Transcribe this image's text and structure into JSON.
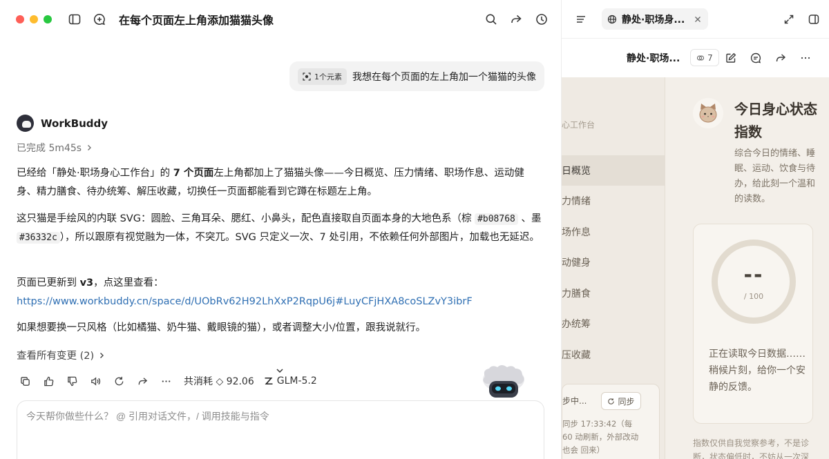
{
  "chat": {
    "title": "在每个页面左上角添加猫猫头像",
    "user_message": {
      "chip_label": "1个元素",
      "text": "我想在每个页面的左上角加一个猫猫的头像"
    },
    "assistant": {
      "name": "WorkBuddy",
      "status": "已完成 5m45s",
      "p1_pre": "已经给「静处·职场身心工作台」的 ",
      "p1_bold": "7 个页面",
      "p1_post": "左上角都加上了猫猫头像——今日概览、压力情绪、职场作息、运动健身、精力膳食、待办统筹、解压收藏，切换任一页面都能看到它蹲在标题左上角。",
      "p2_pre": "这只猫是手绘风的内联 SVG：圆脸、三角耳朵、腮红、小鼻头，配色直接取自页面本身的大地色系（棕 ",
      "p2_code1": "#b08768",
      "p2_mid": " 、墨 ",
      "p2_code2": "#36332c",
      "p2_post": "），所以跟原有视觉融为一体，不突兀。SVG 只定义一次、7 处引用，不依赖任何外部图片，加载也无延迟。",
      "p3_pre": "页面已更新到 ",
      "p3_bold": "v3",
      "p3_post": "，点这里查看：",
      "p3_link": "https://www.workbuddy.cn/space/d/UObRv62H92LhXxP2RqpU6j#LuyCFjHXA8coSLZvY3ibrF",
      "p4": "如果想要换一只风格（比如橘猫、奶牛猫、戴眼镜的猫），或者调整大小/位置，跟我说就行。",
      "changes": "查看所有变更 (2)",
      "cost": "共消耗 ◇ 92.06",
      "model": "GLM-5.2"
    },
    "composer_placeholder": "今天帮你做些什么？ @ 引用对话文件，/ 调用技能与指令"
  },
  "preview": {
    "tab_label": "静处·职场身...",
    "title": "静处·职场...",
    "version_count": "7",
    "brand": "心工作台",
    "nav": [
      "日概览",
      "力情绪",
      "场作息",
      "动健身",
      "力膳食",
      "办统筹",
      "压收藏"
    ],
    "sync_status": "步中...",
    "sync_button": "同步",
    "sync_note": "同步 17:33:42（每 60 动刷新，外部改动也会 回来）",
    "page_title": "今日身心状态指数",
    "page_desc": "综合今日的情绪、睡眠、运动、饮食与待办，给此刻一个温和的读数。",
    "score_value": "--",
    "score_max": "/ 100",
    "score_msg": "正在读取今日数据……稍候片刻，给你一个安静的反馈。",
    "footer": "指数仅供自我觉察参考，不是诊断，状态偏低时，不妨从一次深"
  }
}
